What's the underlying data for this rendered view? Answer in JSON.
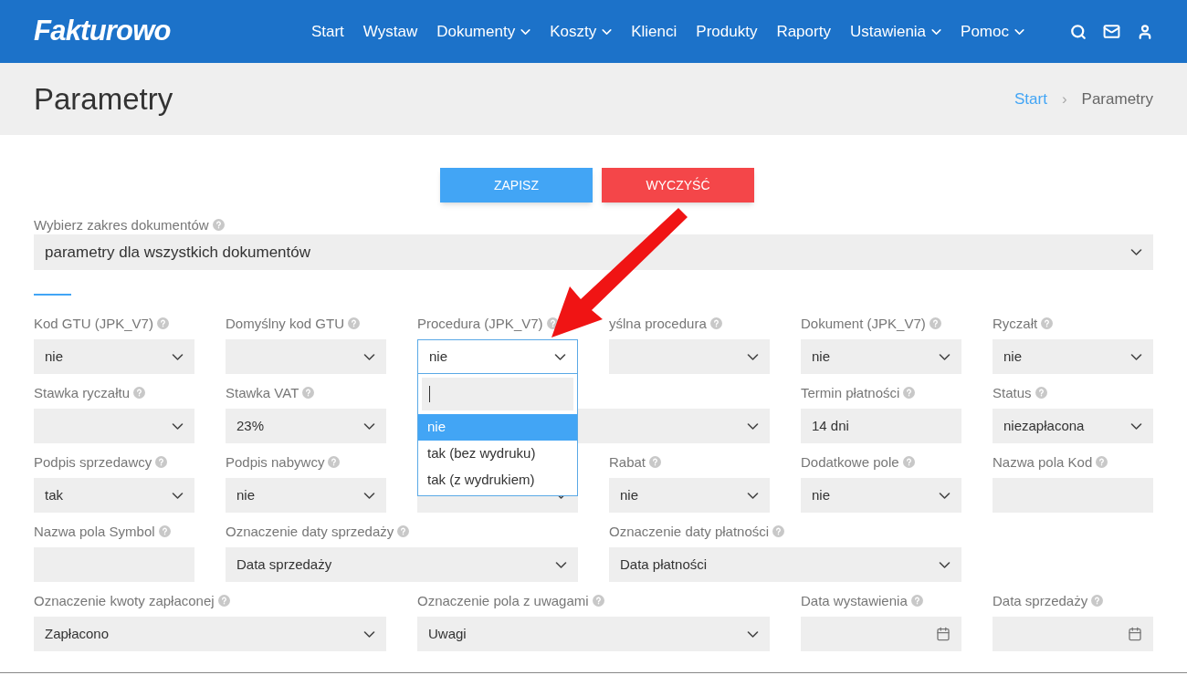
{
  "header": {
    "logo": "Fakturowo",
    "nav": [
      {
        "label": "Start",
        "has_menu": false
      },
      {
        "label": "Wystaw",
        "has_menu": false
      },
      {
        "label": "Dokumenty",
        "has_menu": true
      },
      {
        "label": "Koszty",
        "has_menu": true
      },
      {
        "label": "Klienci",
        "has_menu": false
      },
      {
        "label": "Produkty",
        "has_menu": false
      },
      {
        "label": "Raporty",
        "has_menu": false
      },
      {
        "label": "Ustawienia",
        "has_menu": true
      },
      {
        "label": "Pomoc",
        "has_menu": true
      }
    ]
  },
  "page_title": "Parametry",
  "breadcrumb": [
    {
      "label": "Start",
      "link": true
    },
    {
      "label": "›",
      "kind": "separator"
    },
    {
      "label": "Parametry",
      "link": false
    }
  ],
  "actions": [
    {
      "label": "ZAPISZ",
      "kind": "primary"
    },
    {
      "label": "WYCZYŚĆ",
      "kind": "danger"
    }
  ],
  "scope": {
    "label": "Wybierz zakres dokumentów",
    "value": "parametry dla wszystkich dokumentów"
  },
  "rows": [
    [
      {
        "kind": "select",
        "label": "Kod GTU (JPK_V7)",
        "value": "nie"
      },
      {
        "kind": "select",
        "label": "Domyślny kod GTU"
      },
      {
        "kind": "select",
        "label": "Procedura (JPK_V7)",
        "value": "nie",
        "open": true
      },
      {
        "kind": "select",
        "label": "yślna procedura"
      },
      {
        "kind": "select",
        "label": "Dokument (JPK_V7)",
        "value": "nie"
      },
      {
        "kind": "select",
        "label": "Ryczałt",
        "value": "nie"
      }
    ],
    [
      {
        "kind": "select",
        "label": "Stawka ryczałtu"
      },
      {
        "kind": "select",
        "label": "Stawka VAT",
        "value": "23%"
      },
      {
        "kind": "wide-select"
      },
      {
        "kind": "input",
        "label": "Termin płatności",
        "value": "14 dni"
      },
      {
        "kind": "select",
        "label": "Status",
        "value": "niezapłacona"
      }
    ],
    [
      {
        "kind": "select",
        "label": "Podpis sprzedawcy",
        "value": "tak"
      },
      {
        "kind": "select",
        "label": "Podpis nabywcy",
        "value": "nie"
      },
      {
        "kind": "select"
      },
      {
        "kind": "select",
        "label": "Rabat",
        "value": "nie"
      },
      {
        "kind": "select",
        "label": "Dodatkowe pole",
        "value": "nie"
      },
      {
        "kind": "input",
        "label": "Nazwa pola Kod"
      }
    ],
    [
      {
        "kind": "input",
        "label": "Nazwa pola Symbol"
      },
      {
        "kind": "wide-select",
        "label": "Oznaczenie daty sprzedaży",
        "value": "Data sprzedaży"
      },
      {
        "kind": "wide-select",
        "label": "Oznaczenie daty płatności",
        "value": "Data płatności"
      },
      {
        "kind": "spacer"
      }
    ],
    [
      {
        "kind": "wide-select",
        "label": "Oznaczenie kwoty zapłaconej",
        "value": "Zapłacono"
      },
      {
        "kind": "wide-select",
        "label": "Oznaczenie pola z uwagami",
        "value": "Uwagi"
      },
      {
        "kind": "date",
        "label": "Data wystawienia"
      },
      {
        "kind": "date",
        "label": "Data sprzedaży"
      }
    ]
  ],
  "dropdown": {
    "options": [
      {
        "label": "nie",
        "selected": true
      },
      {
        "label": "tak (bez wydruku)",
        "selected": false
      },
      {
        "label": "tak (z wydrukiem)",
        "selected": false
      }
    ]
  }
}
